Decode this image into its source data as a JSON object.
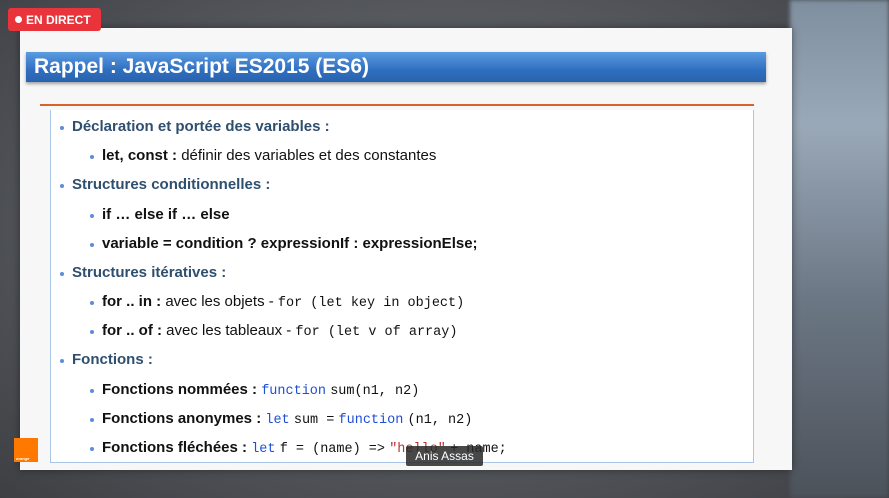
{
  "live_badge": {
    "label": "EN DIRECT"
  },
  "presenter": {
    "name": "Anis Assas"
  },
  "slide": {
    "title": "Rappel : JavaScript ES2015 (ES6)",
    "items": [
      {
        "level": 1,
        "bold": "Déclaration et portée des variables :"
      },
      {
        "level": 2,
        "bold": "let, const :",
        "text": "définir des variables et des constantes"
      },
      {
        "level": 1,
        "bold": "Structures conditionnelles :"
      },
      {
        "level": 2,
        "bold": "if … else if … else"
      },
      {
        "level": 2,
        "bold": "variable = condition ? expressionIf : expressionElse;"
      },
      {
        "level": 1,
        "bold": "Structures itératives :"
      },
      {
        "level": 2,
        "bold": "for .. in :",
        "text": "avec les objets  -",
        "code": "for (let key in object)"
      },
      {
        "level": 2,
        "bold": "for .. of :",
        "text": "avec les tableaux -",
        "code": "for (let v of array)"
      },
      {
        "level": 1,
        "bold": "Fonctions :"
      },
      {
        "level": 2,
        "bold": "Fonctions nommées :",
        "code_kw": "function",
        "code": "sum(n1, n2)"
      },
      {
        "level": 2,
        "bold": "Fonctions anonymes :",
        "code_kw": "let",
        "code": "sum =",
        "code_kw2": "function",
        "code2": "(n1, n2)"
      },
      {
        "level": 2,
        "bold": "Fonctions fléchées :",
        "code_kw": "let",
        "code": "f = (name) =>",
        "code_str": "\"hello\"",
        "code2": "+ name;"
      }
    ]
  },
  "brand": {
    "logo_text": "orange",
    "accent": "#ff7900"
  }
}
